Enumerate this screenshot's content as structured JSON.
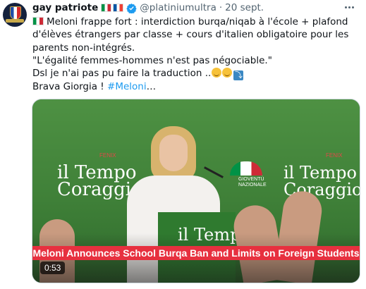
{
  "author": {
    "name": "gay patriote",
    "flags": [
      "flag-italy",
      "flag-france"
    ],
    "verified": true,
    "handle": "@platiniumultra",
    "separator": "·",
    "date": "20 sept."
  },
  "tweet": {
    "line1": "Meloni frappe fort : interdiction burqa/niqab à l'école + plafond d'élèves étrangers par classe + cours d'italien obligatoire pour les parents non-intégrés.",
    "line2": "\"L'égalité femmes-hommes n'est pas négociable.\"",
    "line3": "Dsl je n'ai pas pu faire la traduction ..",
    "line4_prefix": "Brava Giorgia ! ",
    "hashtag": "#Meloni",
    "ellipsis": "…",
    "emojis": [
      "relieved-face-icon",
      "relieved-face-icon",
      "return-arrow-icon"
    ]
  },
  "media": {
    "banner_text": "Meloni Announces School Burqa Ban and Limits on Foreign Students",
    "duration": "0:53",
    "backdrop_left_l1": "il Tempo",
    "backdrop_left_l2": "Coraggio",
    "backdrop_left_del": "del",
    "backdrop_right_l1": "il Tempo",
    "backdrop_right_l2": "Coraggio",
    "backdrop_right_del": "del",
    "backdrop_tag": "FENIX",
    "podium_text": "il Tempo",
    "gn_text_l1": "GIOVENTÙ",
    "gn_text_l2": "NAZIONALE"
  },
  "colors": {
    "link": "#1d9bf0",
    "verified": "#1d9bf0",
    "banner": "#e7303f",
    "stage_green": "#3f8038"
  }
}
